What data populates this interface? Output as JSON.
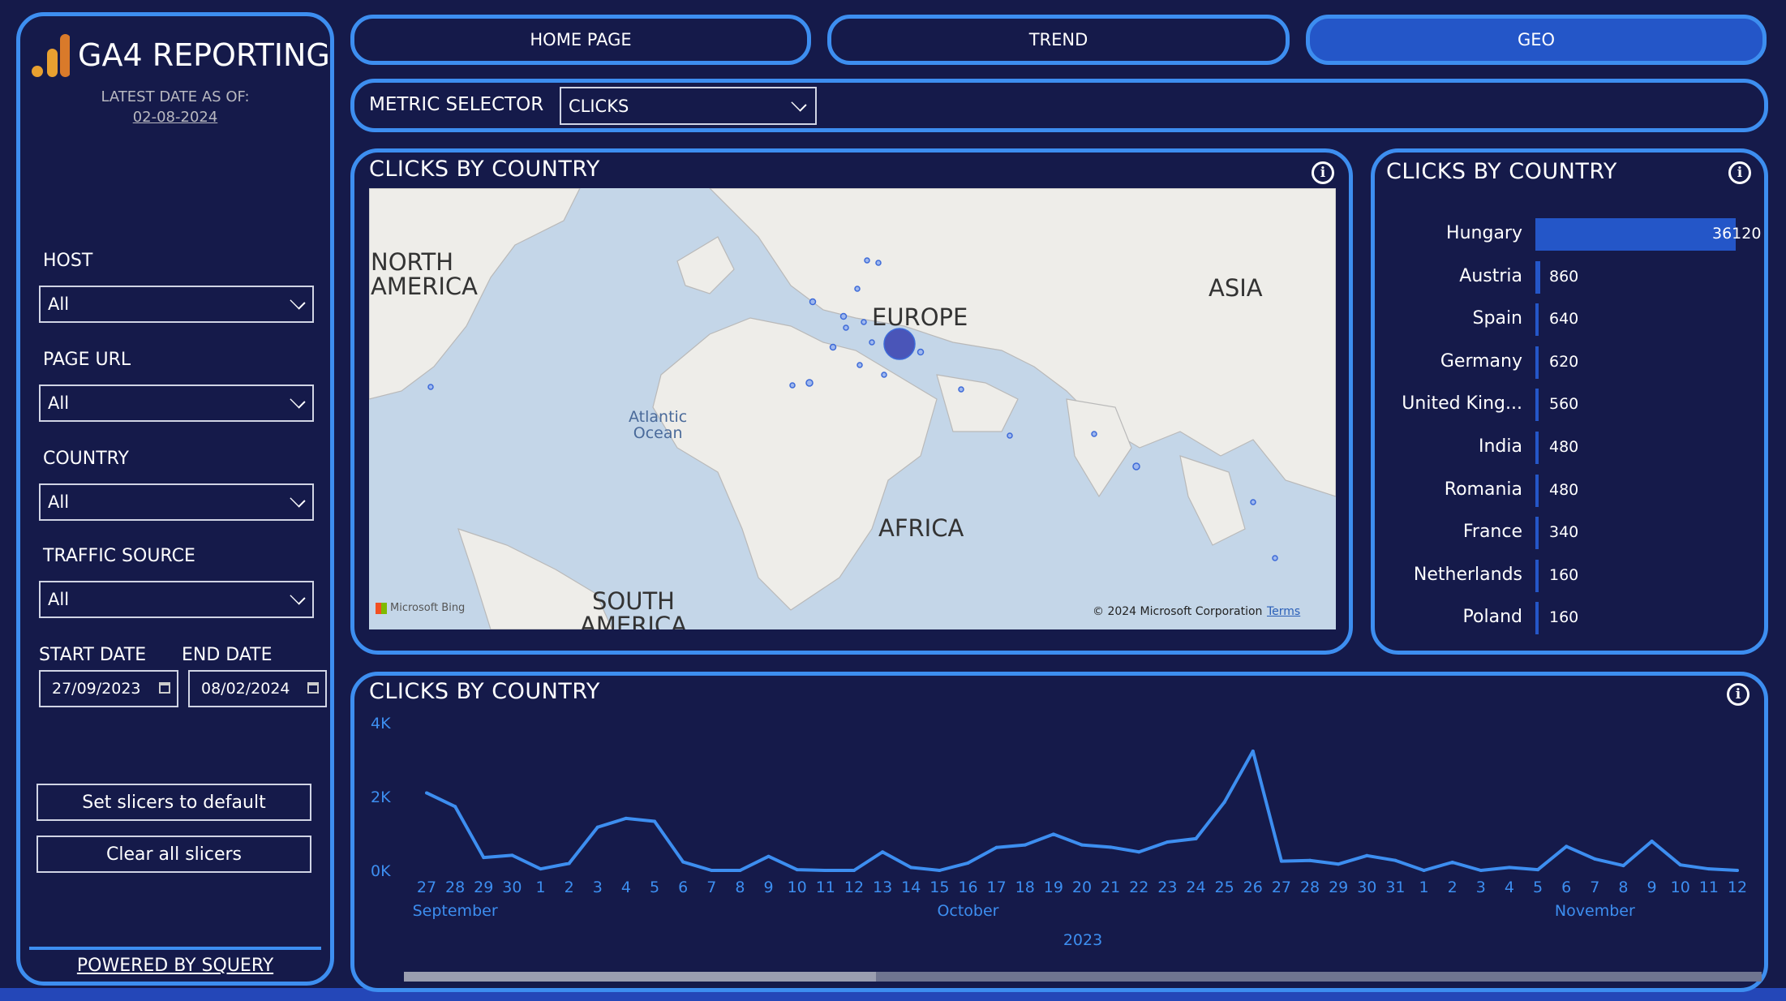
{
  "sidebar": {
    "title": "GA4 REPORTING",
    "latest_label": "LATEST DATE AS OF:",
    "latest_date": "02-08-2024",
    "filters": [
      {
        "label": "HOST",
        "value": "All"
      },
      {
        "label": "PAGE URL",
        "value": "All"
      },
      {
        "label": "COUNTRY",
        "value": "All"
      },
      {
        "label": "TRAFFIC SOURCE",
        "value": "All"
      }
    ],
    "start_label": "START DATE",
    "end_label": "END DATE",
    "start_date": "27/09/2023",
    "end_date": "08/02/2024",
    "reset_button": "Set slicers to default",
    "clear_button": "Clear all slicers",
    "powered": "POWERED BY SQUERY"
  },
  "nav": {
    "home": "HOME PAGE",
    "trend": "TREND",
    "geo": "GEO",
    "active": "GEO"
  },
  "metric": {
    "label": "METRIC SELECTOR",
    "value": "CLICKS"
  },
  "map": {
    "title": "CLICKS BY COUNTRY",
    "labels": {
      "na": "NORTH\nAMERICA",
      "europe": "EUROPE",
      "asia": "ASIA",
      "africa": "AFRICA",
      "sa": "SOUTH\nAMERICA",
      "atlantic": "Atlantic\nOcean"
    },
    "bing": "Microsoft Bing",
    "copyright": "© 2024 Microsoft Corporation",
    "terms": "Terms"
  },
  "bars": {
    "title": "CLICKS BY COUNTRY",
    "color": "#2456c8",
    "items": [
      {
        "country": "Hungary",
        "value": 36120
      },
      {
        "country": "Austria",
        "value": 860
      },
      {
        "country": "Spain",
        "value": 640
      },
      {
        "country": "Germany",
        "value": 620
      },
      {
        "country": "United King...",
        "value": 560
      },
      {
        "country": "India",
        "value": 480
      },
      {
        "country": "Romania",
        "value": 480
      },
      {
        "country": "France",
        "value": 340
      },
      {
        "country": "Netherlands",
        "value": 160
      },
      {
        "country": "Poland",
        "value": 160
      }
    ]
  },
  "chart_data": {
    "type": "line",
    "title": "CLICKS BY COUNTRY",
    "ylim": [
      0,
      4000
    ],
    "yticks": [
      "0K",
      "2K",
      "4K"
    ],
    "year_label": "2023",
    "months": [
      {
        "name": "September",
        "index": 1
      },
      {
        "name": "October",
        "index": 19
      },
      {
        "name": "November",
        "index": 41
      }
    ],
    "x": [
      "27",
      "28",
      "29",
      "30",
      "1",
      "2",
      "3",
      "4",
      "5",
      "6",
      "7",
      "8",
      "9",
      "10",
      "11",
      "12",
      "13",
      "14",
      "15",
      "16",
      "17",
      "18",
      "19",
      "20",
      "21",
      "22",
      "23",
      "24",
      "25",
      "26",
      "27",
      "28",
      "29",
      "30",
      "31",
      "1",
      "2",
      "3",
      "4",
      "5",
      "6",
      "7",
      "8",
      "9",
      "10",
      "11",
      "12"
    ],
    "values": [
      2100,
      1730,
      350,
      410,
      40,
      190,
      1170,
      1410,
      1330,
      230,
      0,
      0,
      380,
      20,
      0,
      0,
      500,
      80,
      0,
      200,
      620,
      690,
      980,
      690,
      630,
      500,
      770,
      860,
      1850,
      3230,
      250,
      270,
      170,
      400,
      270,
      0,
      220,
      0,
      80,
      20,
      650,
      310,
      130,
      790,
      150,
      40,
      0
    ],
    "color": "#3d8ef0"
  }
}
